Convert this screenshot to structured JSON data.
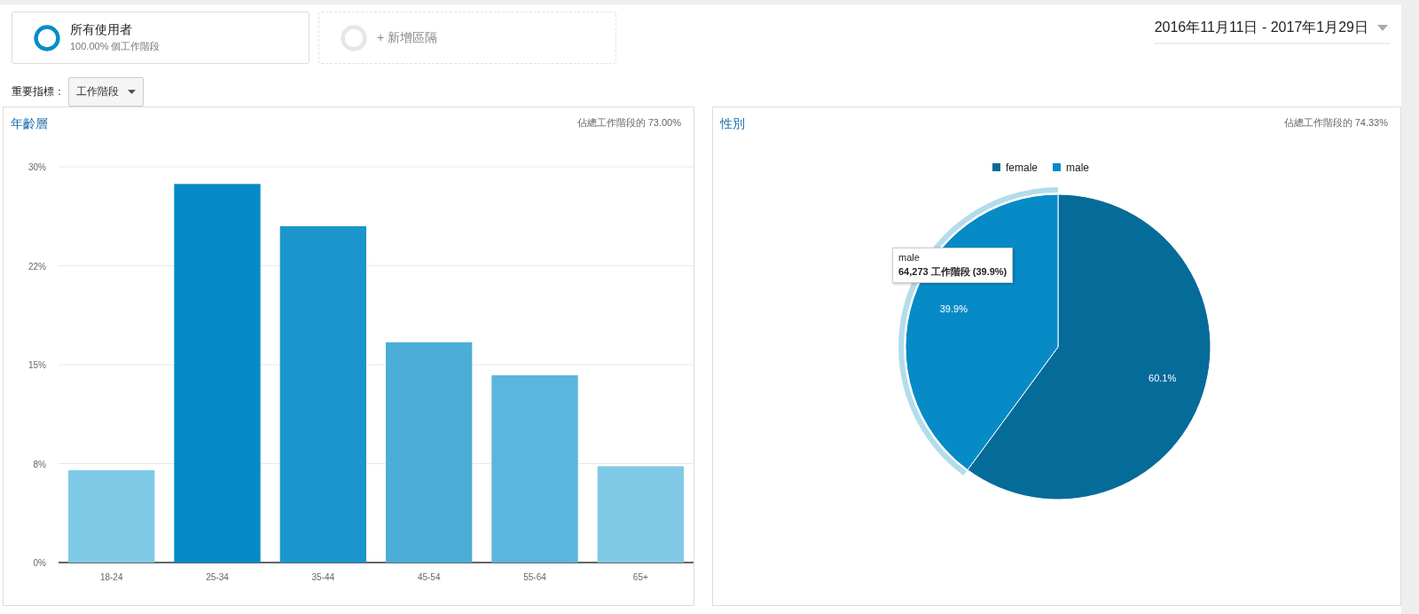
{
  "segments": [
    {
      "kind": "active",
      "title": "所有使用者",
      "subtitle": "100.00% 個工作階段"
    },
    {
      "kind": "add",
      "title": "+ 新增區隔"
    }
  ],
  "date_range": {
    "label": "2016年11月11日 - 2017年1月29日"
  },
  "metric": {
    "label": "重要指標：",
    "value": "工作階段"
  },
  "panels": [
    {
      "title": "年齡層",
      "share": "佔總工作階段的 73.00%",
      "chart_data": {
        "type": "bar",
        "categories": [
          "18-24",
          "25-34",
          "35-44",
          "45-54",
          "55-64",
          "65+"
        ],
        "values": [
          7.0,
          28.7,
          25.5,
          16.7,
          14.2,
          7.3
        ],
        "colors": [
          "#7ecae6",
          "#058bc7",
          "#1b96cc",
          "#4aaed9",
          "#5cb5dd",
          "#80c9e6"
        ],
        "grid": true,
        "ylim": [
          0,
          30
        ],
        "yticks": [
          {
            "value": 0,
            "label": "0%"
          },
          {
            "value": 7.5,
            "label": "8%"
          },
          {
            "value": 15,
            "label": "15%"
          },
          {
            "value": 22.5,
            "label": "22%"
          },
          {
            "value": 30,
            "label": "30%"
          }
        ]
      }
    },
    {
      "title": "性別",
      "share": "佔總工作階段的 74.33%",
      "chart_data": {
        "type": "pie",
        "categories": [
          "female",
          "male"
        ],
        "values": [
          60.1,
          39.9
        ],
        "colors": [
          "#056b99",
          "#068bc7"
        ],
        "value_labels": [
          "60.1%",
          "39.9%"
        ],
        "legend": true
      },
      "slice_selected": [
        false,
        true
      ],
      "tooltip": {
        "title": "male",
        "text": "64,273 工作階段 (39.9%)"
      }
    }
  ]
}
